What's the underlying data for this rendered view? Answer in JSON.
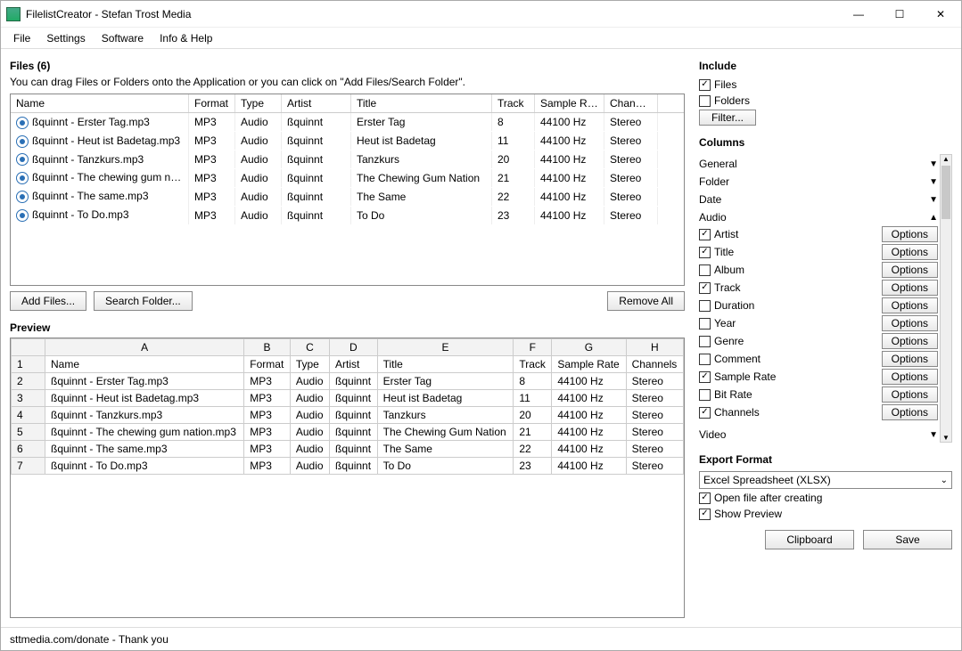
{
  "titlebar": {
    "title": "FilelistCreator - Stefan Trost Media"
  },
  "menu": {
    "file": "File",
    "settings": "Settings",
    "software": "Software",
    "info": "Info & Help"
  },
  "files": {
    "heading": "Files (6)",
    "hint": "You can drag Files or Folders onto the Application or you can click on \"Add Files/Search Folder\".",
    "headers": {
      "name": "Name",
      "format": "Format",
      "type": "Type",
      "artist": "Artist",
      "title": "Title",
      "track": "Track",
      "sr": "Sample Rate",
      "ch": "Channels"
    },
    "rows": [
      {
        "name": "ßquinnt - Erster Tag.mp3",
        "format": "MP3",
        "type": "Audio",
        "artist": "ßquinnt",
        "title": "Erster Tag",
        "track": "8",
        "sr": "44100 Hz",
        "ch": "Stereo"
      },
      {
        "name": "ßquinnt - Heut ist Badetag.mp3",
        "format": "MP3",
        "type": "Audio",
        "artist": "ßquinnt",
        "title": "Heut ist Badetag",
        "track": "11",
        "sr": "44100 Hz",
        "ch": "Stereo"
      },
      {
        "name": "ßquinnt - Tanzkurs.mp3",
        "format": "MP3",
        "type": "Audio",
        "artist": "ßquinnt",
        "title": "Tanzkurs",
        "track": "20",
        "sr": "44100 Hz",
        "ch": "Stereo"
      },
      {
        "name": "ßquinnt - The chewing gum na...",
        "format": "MP3",
        "type": "Audio",
        "artist": "ßquinnt",
        "title": "The Chewing Gum Nation",
        "track": "21",
        "sr": "44100 Hz",
        "ch": "Stereo"
      },
      {
        "name": "ßquinnt - The same.mp3",
        "format": "MP3",
        "type": "Audio",
        "artist": "ßquinnt",
        "title": "The Same",
        "track": "22",
        "sr": "44100 Hz",
        "ch": "Stereo"
      },
      {
        "name": "ßquinnt - To Do.mp3",
        "format": "MP3",
        "type": "Audio",
        "artist": "ßquinnt",
        "title": "To Do",
        "track": "23",
        "sr": "44100 Hz",
        "ch": "Stereo"
      }
    ],
    "buttons": {
      "add": "Add Files...",
      "search": "Search Folder...",
      "remove": "Remove All"
    }
  },
  "preview": {
    "heading": "Preview",
    "cols": [
      "",
      "A",
      "B",
      "C",
      "D",
      "E",
      "F",
      "G",
      "H"
    ],
    "header_row": [
      "Name",
      "Format",
      "Type",
      "Artist",
      "Title",
      "Track",
      "Sample Rate",
      "Channels"
    ],
    "rows": [
      [
        "ßquinnt - Erster Tag.mp3",
        "MP3",
        "Audio",
        "ßquinnt",
        "Erster Tag",
        "8",
        "44100 Hz",
        "Stereo"
      ],
      [
        "ßquinnt - Heut ist Badetag.mp3",
        "MP3",
        "Audio",
        "ßquinnt",
        "Heut ist Badetag",
        "11",
        "44100 Hz",
        "Stereo"
      ],
      [
        "ßquinnt - Tanzkurs.mp3",
        "MP3",
        "Audio",
        "ßquinnt",
        "Tanzkurs",
        "20",
        "44100 Hz",
        "Stereo"
      ],
      [
        "ßquinnt - The chewing gum nation.mp3",
        "MP3",
        "Audio",
        "ßquinnt",
        "The Chewing Gum Nation",
        "21",
        "44100 Hz",
        "Stereo"
      ],
      [
        "ßquinnt - The same.mp3",
        "MP3",
        "Audio",
        "ßquinnt",
        "The Same",
        "22",
        "44100 Hz",
        "Stereo"
      ],
      [
        "ßquinnt - To Do.mp3",
        "MP3",
        "Audio",
        "ßquinnt",
        "To Do",
        "23",
        "44100 Hz",
        "Stereo"
      ]
    ]
  },
  "status": {
    "text": "sttmedia.com/donate - Thank you"
  },
  "side": {
    "include": {
      "heading": "Include",
      "files": "Files",
      "folders": "Folders",
      "filter": "Filter..."
    },
    "columns": {
      "heading": "Columns",
      "groups": {
        "general": "General",
        "folder": "Folder",
        "date": "Date",
        "audio": "Audio",
        "video": "Video"
      },
      "audio_items": [
        {
          "label": "Artist",
          "checked": true
        },
        {
          "label": "Title",
          "checked": true
        },
        {
          "label": "Album",
          "checked": false
        },
        {
          "label": "Track",
          "checked": true
        },
        {
          "label": "Duration",
          "checked": false
        },
        {
          "label": "Year",
          "checked": false
        },
        {
          "label": "Genre",
          "checked": false
        },
        {
          "label": "Comment",
          "checked": false
        },
        {
          "label": "Sample Rate",
          "checked": true
        },
        {
          "label": "Bit Rate",
          "checked": false
        },
        {
          "label": "Channels",
          "checked": true
        }
      ],
      "options": "Options"
    },
    "export": {
      "heading": "Export Format",
      "format": "Excel Spreadsheet (XLSX)",
      "open": "Open file after creating",
      "preview": "Show Preview",
      "clipboard": "Clipboard",
      "save": "Save"
    }
  }
}
